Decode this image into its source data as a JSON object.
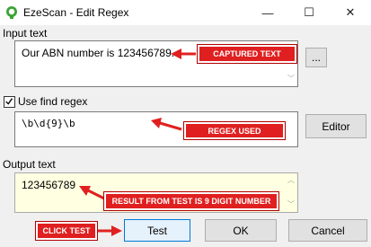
{
  "window": {
    "title": "EzeScan - Edit Regex",
    "minimize_glyph": "—",
    "maximize_glyph": "☐",
    "close_glyph": "✕",
    "icon": "ezescan-icon"
  },
  "input": {
    "label": "Input text",
    "value": "Our ABN number is 123456789.",
    "browse_label": "..."
  },
  "regex": {
    "checkbox_label": "Use find regex",
    "checked": true,
    "check_glyph": "✓",
    "value": "\\b\\d{9}\\b",
    "editor_label": "Editor"
  },
  "output": {
    "label": "Output text",
    "value": "123456789"
  },
  "buttons": {
    "test": "Test",
    "ok": "OK",
    "cancel": "Cancel"
  },
  "scroll_glyphs": {
    "up": "︿",
    "down": "﹀"
  },
  "annotations": {
    "captured": "CAPTURED TEXT",
    "regex_used": "REGEX USED",
    "result": "RESULT FROM TEST IS 9 DIGIT NUMBER",
    "click_test": "CLICK TEST"
  },
  "colors": {
    "annotation_red": "#e02020",
    "output_bg": "#ffffe1",
    "icon_green": "#3aa335"
  }
}
